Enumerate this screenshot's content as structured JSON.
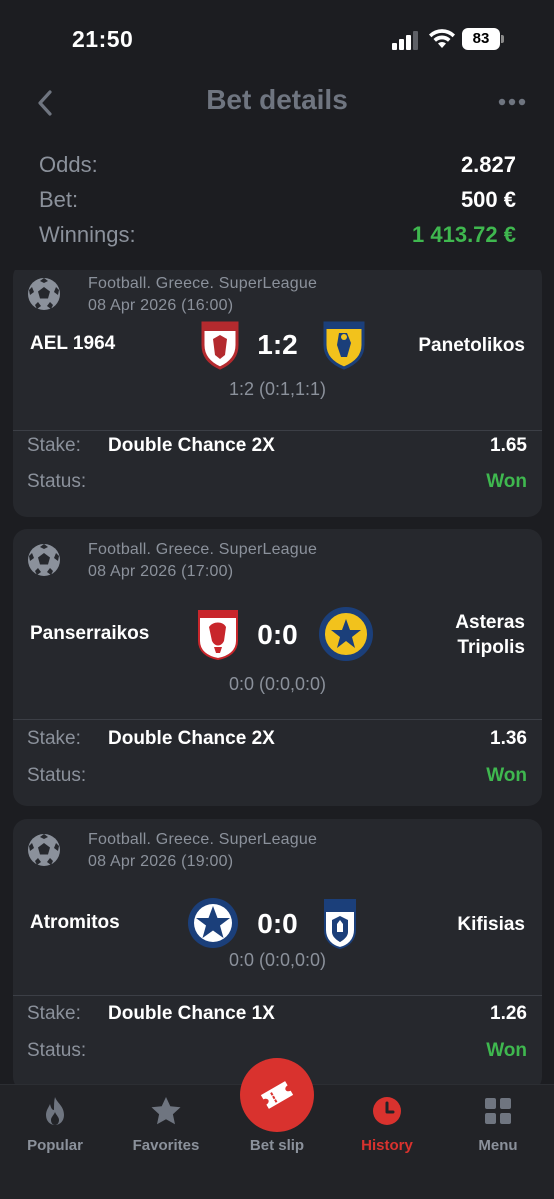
{
  "status_bar": {
    "time": "21:50",
    "battery": "83",
    "icons": [
      "signal-icon",
      "wifi-icon",
      "battery-icon"
    ]
  },
  "header": {
    "title": "Bet details",
    "back_icon": "chevron-left-icon",
    "more_icon": "more-horizontal-icon"
  },
  "summary": {
    "odds_label": "Odds:",
    "odds_value": "2.827",
    "bet_label": "Bet:",
    "bet_value": "500 €",
    "winnings_label": "Winnings:",
    "winnings_value": "1 413.72 €"
  },
  "cards": [
    {
      "league": "Football. Greece. SuperLeague",
      "date": "08 Apr 2026 (16:00)",
      "home": "AEL 1964",
      "away_line1": "Panetolikos",
      "away_line2": "",
      "score": "1:2",
      "score_detail": "1:2 (0:1,1:1)",
      "stake_label": "Stake:",
      "stake": "Double Chance 2X",
      "odd": "1.65",
      "status_label": "Status:",
      "status": "Won"
    },
    {
      "league": "Football. Greece. SuperLeague",
      "date": "08 Apr 2026 (17:00)",
      "home": "Panserraikos",
      "away_line1": "Asteras",
      "away_line2": "Tripolis",
      "score": "0:0",
      "score_detail": "0:0 (0:0,0:0)",
      "stake_label": "Stake:",
      "stake": "Double Chance 2X",
      "odd": "1.36",
      "status_label": "Status:",
      "status": "Won"
    },
    {
      "league": "Football. Greece. SuperLeague",
      "date": "08 Apr 2026 (19:00)",
      "home": "Atromitos",
      "away_line1": "Kifisias",
      "away_line2": "",
      "score": "0:0",
      "score_detail": "0:0 (0:0,0:0)",
      "stake_label": "Stake:",
      "stake": "Double Chance 1X",
      "odd": "1.26",
      "status_label": "Status:",
      "status": "Won"
    }
  ],
  "tabs": [
    {
      "label": "Popular",
      "icon": "flame-icon"
    },
    {
      "label": "Favorites",
      "icon": "star-icon"
    },
    {
      "label": "Bet slip",
      "icon": "ticket-icon"
    },
    {
      "label": "History",
      "icon": "clock-icon",
      "active": true
    },
    {
      "label": "Menu",
      "icon": "grid-icon"
    }
  ],
  "colors": {
    "background": "#1c1d21",
    "card": "#26282d",
    "accent_red": "#d9322e",
    "win_green": "#3fb84f",
    "muted_text": "#8b919b"
  }
}
